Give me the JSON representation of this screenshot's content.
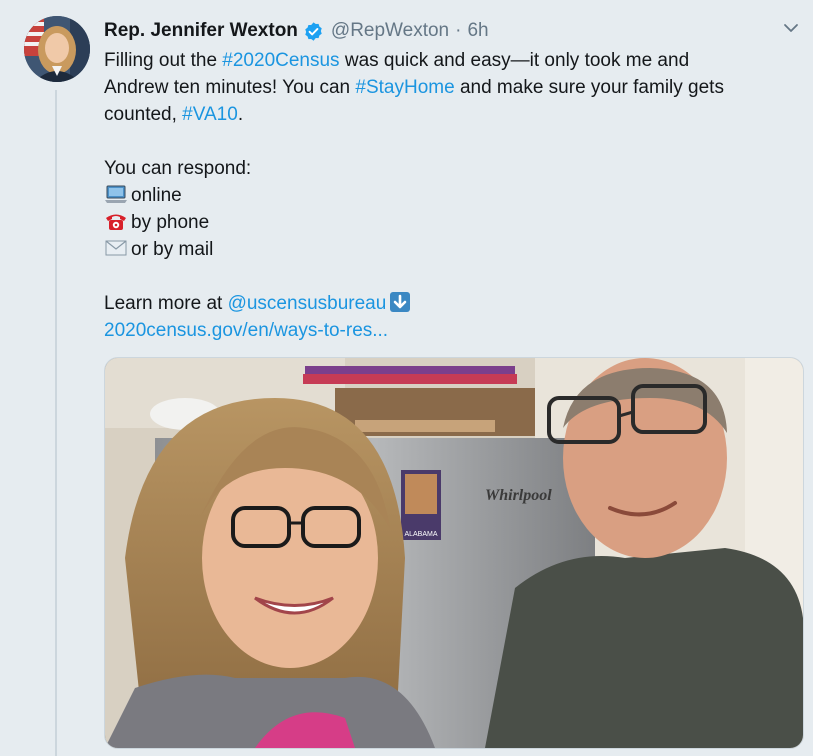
{
  "tweet": {
    "display_name": "Rep. Jennifer Wexton",
    "handle": "@RepWexton",
    "separator": "·",
    "time": "6h",
    "icons": {
      "verified": "verified-badge-icon",
      "menu": "chevron-down-icon",
      "laptop": "laptop-emoji-icon",
      "phone": "telephone-emoji-icon",
      "mail": "envelope-emoji-icon",
      "arrow": "down-arrow-emoji-icon"
    },
    "text": {
      "l1_pre": "Filling out the ",
      "l1_tag": "#2020Census",
      "l1_post": " was quick and easy—it only took me and",
      "l2_pre": "Andrew ten minutes! You can ",
      "l2_tag": "#StayHome",
      "l2_post": " and make sure your family gets",
      "l3_pre": "counted, ",
      "l3_tag": "#VA10",
      "l3_post": ".",
      "respond": "You can respond:",
      "opt_online": "online",
      "opt_phone": "by phone",
      "opt_mail": "or by mail",
      "learn_pre": "Learn more at ",
      "learn_mention": "@uscensusbureau",
      "link": "2020census.gov/en/ways-to-res..."
    },
    "media": {
      "magnet_text": "ALABAMA",
      "fridge_brand": "Whirlpool"
    },
    "colors": {
      "link": "#1b95e0",
      "text": "#14171a",
      "muted": "#657786",
      "background": "#e6ecf0"
    }
  }
}
